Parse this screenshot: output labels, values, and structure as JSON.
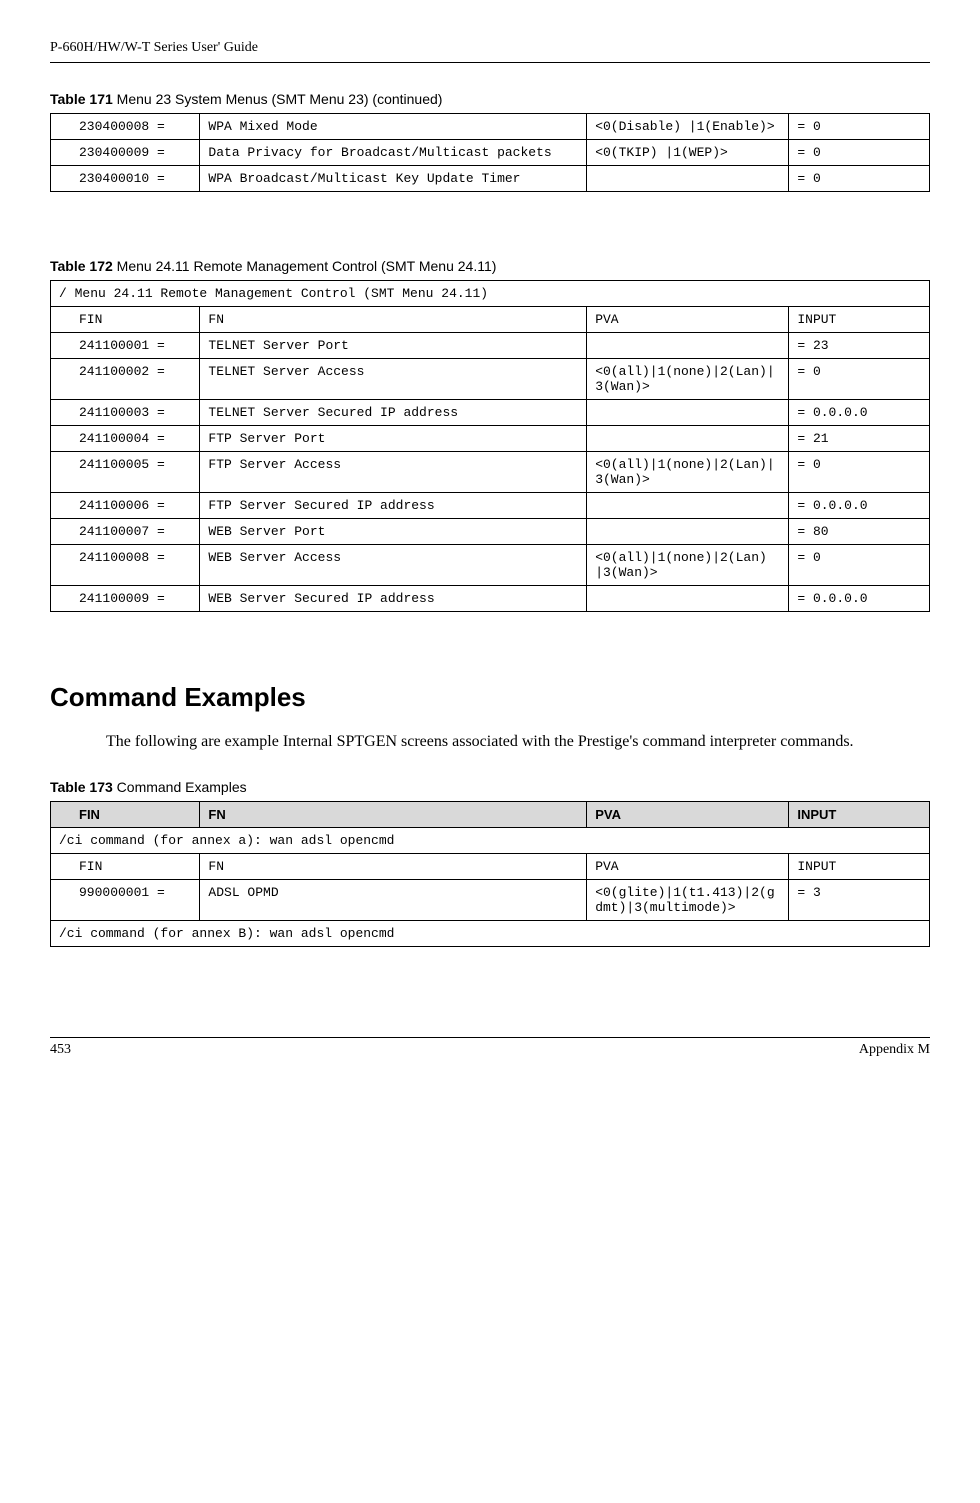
{
  "header": {
    "title": "P-660H/HW/W-T Series User' Guide"
  },
  "table171": {
    "caption_prefix": "Table 171",
    "caption_rest": "   Menu 23 System Menus (SMT Menu 23) (continued)",
    "rows": [
      {
        "fin": "230400008 =",
        "fn": "WPA Mixed Mode",
        "pva": " <0(Disable) |1(Enable)>",
        "input": "= 0"
      },
      {
        "fin": "230400009 =",
        "fn": "Data Privacy for Broadcast/Multicast packets",
        "pva": " <0(TKIP) |1(WEP)>",
        "input": "= 0"
      },
      {
        "fin": "230400010 =",
        "fn": "WPA Broadcast/Multicast Key Update Timer",
        "pva": "",
        "input": "= 0"
      }
    ]
  },
  "table172": {
    "caption_prefix": "Table 172",
    "caption_rest": "   Menu 24.11 Remote Management Control (SMT Menu 24.11)",
    "title_row": "/ Menu 24.11 Remote Management Control (SMT Menu 24.11)",
    "head": {
      "fin": "FIN",
      "fn": "FN",
      "pva": "PVA",
      "input": "INPUT"
    },
    "rows": [
      {
        "fin": "241100001 =",
        "fn": "TELNET Server Port",
        "pva": "",
        "input": "= 23"
      },
      {
        "fin": "241100002 =",
        "fn": "TELNET Server Access",
        "pva": "<0(all)|1(none)|2(Lan)|3(Wan)>",
        "input": "= 0"
      },
      {
        "fin": "241100003 =",
        "fn": "TELNET Server Secured IP address",
        "pva": "",
        "input": "= 0.0.0.0"
      },
      {
        "fin": "241100004 =",
        "fn": "FTP Server Port",
        "pva": "",
        "input": "= 21"
      },
      {
        "fin": "241100005 =",
        "fn": "FTP Server Access",
        "pva": "<0(all)|1(none)|2(Lan)|3(Wan)>",
        "input": "= 0"
      },
      {
        "fin": "241100006 =",
        "fn": "FTP Server Secured IP address",
        "pva": "",
        "input": "= 0.0.0.0"
      },
      {
        "fin": "241100007 =",
        "fn": "WEB Server Port",
        "pva": "",
        "input": "= 80"
      },
      {
        "fin": "241100008 =",
        "fn": "WEB Server Access",
        "pva": "<0(all)|1(none)|2(Lan) |3(Wan)>",
        "input": "= 0"
      },
      {
        "fin": "241100009 =",
        "fn": "WEB Server Secured IP address",
        "pva": "",
        "input": "= 0.0.0.0"
      }
    ]
  },
  "section": {
    "heading": "Command Examples",
    "paragraph": "The following are example Internal SPTGEN screens associated with the Prestige's command interpreter commands."
  },
  "table173": {
    "caption_prefix": "Table 173",
    "caption_rest": "   Command Examples",
    "head": {
      "fin": "FIN",
      "fn": "FN",
      "pva": "PVA",
      "input": "INPUT"
    },
    "span1": "/ci command (for annex a): wan adsl opencmd",
    "subhead": {
      "fin": "FIN",
      "fn": "FN",
      "pva": "PVA",
      "input": "INPUT"
    },
    "row": {
      "fin": "990000001 =",
      "fn": "ADSL OPMD",
      "pva": "<0(glite)|1(t1.413)|2(gdmt)|3(multimode)>",
      "input": "= 3"
    },
    "span2": "/ci command (for annex B): wan adsl opencmd"
  },
  "footer": {
    "page": "453",
    "appendix": "Appendix M"
  }
}
